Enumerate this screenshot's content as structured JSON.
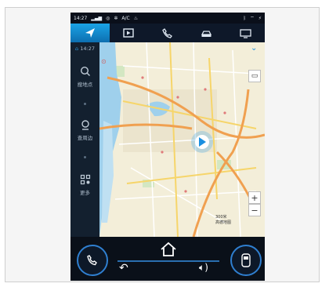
{
  "status": {
    "time": "14:27",
    "ac": "A/C"
  },
  "side": {
    "time": "14:27",
    "items": [
      {
        "label": "搜地点"
      },
      {
        "label": "查周边"
      },
      {
        "label": "更多"
      }
    ]
  },
  "map": {
    "scale": "300米",
    "brand": "高德地图"
  },
  "colors": {
    "accent": "#1aa3e6",
    "ring": "#2f7fd0",
    "water": "#9fd0ec",
    "highway": "#f0a050"
  }
}
